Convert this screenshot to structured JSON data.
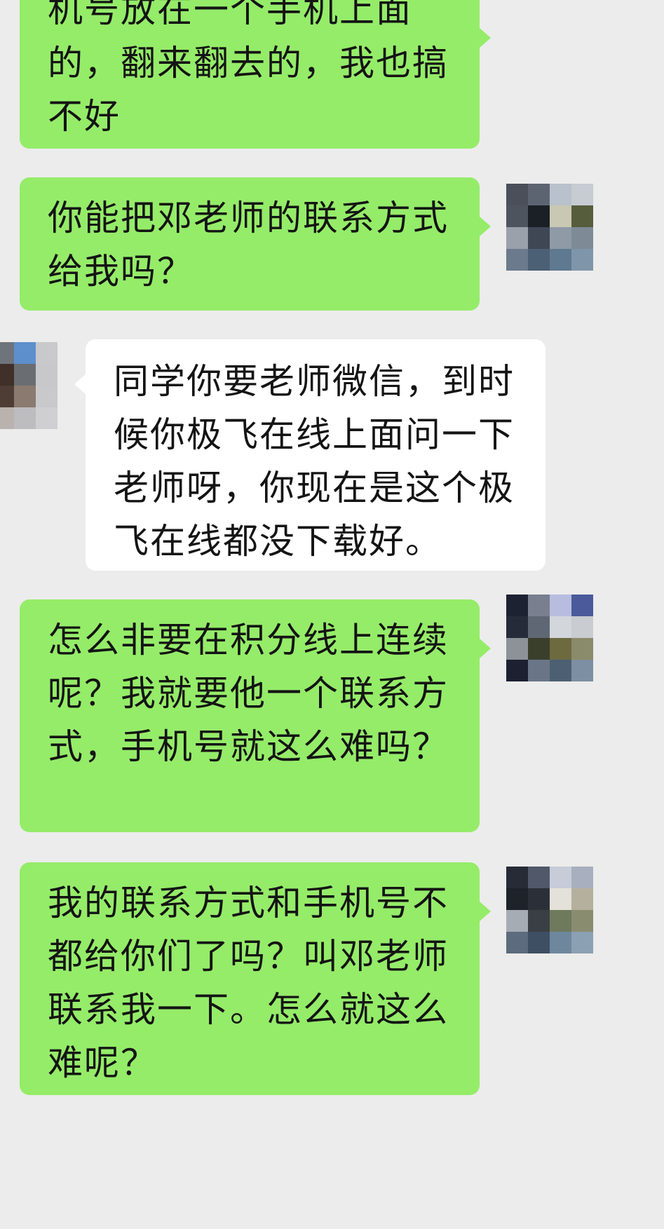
{
  "messages": [
    {
      "side": "sent",
      "text": "机号放在一个手机上面的，翻来翻去的，我也搞不好",
      "has_avatar": false
    },
    {
      "side": "sent",
      "text": "你能把邓老师的联系方式给我吗？",
      "has_avatar": true
    },
    {
      "side": "received",
      "text": "同学你要老师微信，到时候你极飞在线上面问一下老师呀，你现在是这个极飞在线都没下载好。",
      "has_avatar": true
    },
    {
      "side": "sent",
      "text": " 怎么非要在积分线上连续呢？我就要他一个联系方式，手机号就这么难吗？",
      "has_avatar": true
    },
    {
      "side": "sent",
      "text": "我的联系方式和手机号不都给你们了吗？叫邓老师联系我一下。怎么就这么难呢？",
      "has_avatar": true
    }
  ],
  "colors": {
    "background": "#ececec",
    "sent_bubble": "#95ec69",
    "received_bubble": "#ffffff",
    "text": "#141414"
  },
  "avatars": {
    "self": [
      "#4b4f5a",
      "#5d6471",
      "#b9c1cc",
      "#c7ccd3",
      "#4e545e",
      "#1b1f26",
      "#c9c8b2",
      "#565d3d",
      "#9aa1ab",
      "#3f4654",
      "#8f9aa6",
      "#7e8b96",
      "#6b7a8c",
      "#4c6075",
      "#5f7990",
      "#7f96aa"
    ],
    "self_2": [
      "#1d2233",
      "#7a7f8f",
      "#b8bde0",
      "#4a5a9a",
      "#262b3a",
      "#5f6674",
      "#d3d6db",
      "#c9ccd1",
      "#8d9299",
      "#3a3f2c",
      "#6d6a3f",
      "#8a8b6a",
      "#1c2030",
      "#6a7688",
      "#4d5f73",
      "#7d8fa2"
    ],
    "self_3": [
      "#272b36",
      "#50586a",
      "#c8ccd8",
      "#a8afbf",
      "#1e2229",
      "#2b3038",
      "#e3e1da",
      "#b5b09e",
      "#a6acb4",
      "#3a3f46",
      "#6f7a5c",
      "#8a8c70",
      "#5c6b7d",
      "#3e4f63",
      "#6f879d",
      "#8ca0b3"
    ],
    "self_4": [
      "#2a2e3a",
      "#4b5363",
      "#c7ccd6",
      "#9ea7b6",
      "#1f232b",
      "#2f343c",
      "#e2e0d8",
      "#aaa592",
      "#9aa1aa",
      "#353a42",
      "#737d60",
      "#8f9175",
      "#5b6a7c",
      "#415264",
      "#6c849a",
      "#8a9eb1"
    ],
    "other": [
      "#7d6a60",
      "#6f747c",
      "#5c8fcc",
      "#c9c9cc",
      "#a7866f",
      "#40302a",
      "#6a6e72",
      "#c8c8cb",
      "#c4a791",
      "#4e3d35",
      "#8a7a70",
      "#c9c9cb",
      "#d6c7bd",
      "#b9b2ae",
      "#bdbcbf",
      "#cfcfd1"
    ]
  }
}
